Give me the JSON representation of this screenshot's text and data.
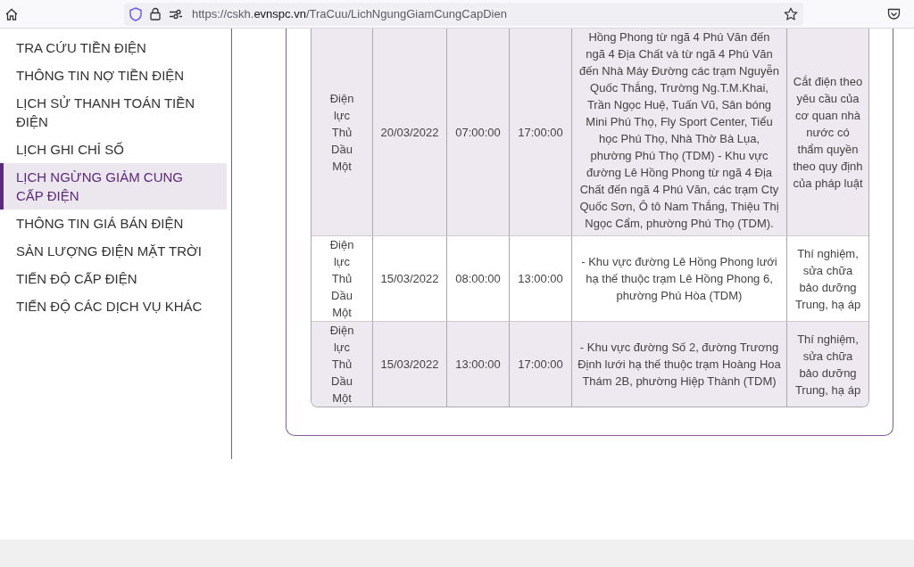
{
  "browser": {
    "url_prefix": "https://cskh.",
    "url_domain": "evnspc.vn",
    "url_path": "/TraCuu/LichNgungGiamCungCapDien"
  },
  "sidebar": {
    "items": [
      {
        "label": "TRA CỨU TIỀN ĐIỆN",
        "selected": false
      },
      {
        "label": "THÔNG TIN NỢ TIỀN ĐIỆN",
        "selected": false
      },
      {
        "label": "LỊCH SỬ THANH TOÁN TIỀN ĐIỆN",
        "selected": false
      },
      {
        "label": "LỊCH GHI CHỈ SỐ",
        "selected": false
      },
      {
        "label": "LỊCH NGỪNG GIẢM CUNG CẤP ĐIỆN",
        "selected": true
      },
      {
        "label": "THÔNG TIN GIÁ BÁN ĐIỆN",
        "selected": false
      },
      {
        "label": "SẢN LƯỢNG ĐIỆN MẶT TRỜI",
        "selected": false
      },
      {
        "label": "TIẾN ĐỘ CẤP ĐIỆN",
        "selected": false
      },
      {
        "label": "TIẾN ĐỘ CÁC DỊCH VỤ KHÁC",
        "selected": false
      }
    ]
  },
  "table": {
    "rows": [
      [
        "Điện lực Thủ Dầu Một",
        "20/03/2022",
        "07:00:00",
        "17:00:00",
        "Hồng Phong từ ngã 4 Phú Văn đến ngã 4 Địa Chất và từ ngã 4 Phú Văn đến Nhà Máy Đường các trạm Nguyễn Quốc Thắng, Trường Ng.T.M.Khai, Trần Ngọc Huệ, Tuấn Vũ, Sân bóng Mini Phú Thọ, Fly Sport Center, Tiểu học Phú Thọ, Nhà Thờ Bà Lụa, phường Phú Thọ (TDM) - Khu vực đường Lê Hồng Phong từ ngã 4 Địa Chất đến ngã 4 Phú Văn, các trạm Cty Quốc Sơn, Ô tô Nam Thắng, Thiệu Thị Ngọc Cẩm, phường Phú Thọ (TDM).",
        "Cắt điện theo yêu cầu của cơ quan nhà nước có thẩm quyền theo quy định của pháp luật"
      ],
      [
        "Điện lực Thủ Dầu Một",
        "15/03/2022",
        "08:00:00",
        "13:00:00",
        "- Khu vực đường Lê Hồng Phong lưới hạ thế thuộc trạm Lê Hồng Phong 6, phường Phú Hòa (TDM)",
        "Thí nghiệm, sửa chữa bảo dưỡng Trung, hạ áp"
      ],
      [
        "Điện lực Thủ Dầu Một",
        "15/03/2022",
        "13:00:00",
        "17:00:00",
        "- Khu vực đường Số 2, đường Trương Định lưới hạ thế thuộc trạm Hoàng Hoa Thám 2B, phường Hiệp Thành (TDM)",
        "Thí nghiệm, sửa chữa bảo dưỡng Trung, hạ áp"
      ]
    ]
  }
}
